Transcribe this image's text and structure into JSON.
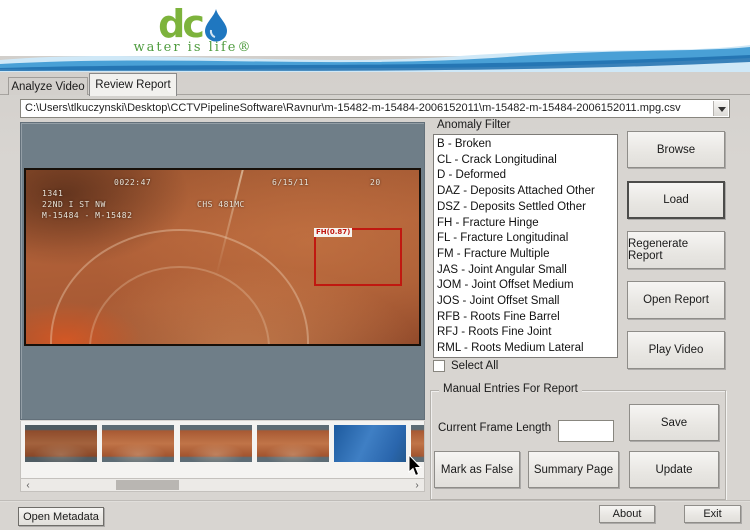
{
  "header": {
    "logo_text": "dc",
    "logo_tagline": "water is life®"
  },
  "tabs": {
    "analyze": "Analyze Video",
    "review": "Review Report"
  },
  "file_path": "C:\\Users\\tlkuczynski\\Desktop\\CCTVPipelineSoftware\\Ravnur\\m-15482-m-15484-2006152011\\m-15482-m-15484-2006152011.mpg.csv",
  "video_overlay": {
    "counter": "0022:47",
    "date": "6/15/11",
    "right_value": "20",
    "line1": "1341",
    "street": "22ND I ST NW",
    "chs": "CHS 481MC",
    "segment": "M-15484 - M-15482",
    "annotation": "FH(0.87)"
  },
  "anomaly_filter": {
    "label": "Anomaly Filter",
    "select_all": "Select All",
    "items": [
      "B - Broken",
      "CL - Crack Longitudinal",
      "D - Deformed",
      "DAZ - Deposits Attached Other",
      "DSZ - Deposits Settled Other",
      "FH - Fracture Hinge",
      "FL - Fracture Longitudinal",
      "FM - Fracture Multiple",
      "JAS - Joint Angular Small",
      "JOM - Joint Offset Medium",
      "JOS - Joint Offset Small",
      "RFB - Roots Fine Barrel",
      "RFJ - Roots Fine Joint",
      "RML - Roots Medium Lateral"
    ]
  },
  "action_buttons": {
    "browse": "Browse",
    "load": "Load",
    "regenerate_report": "Regenerate Report",
    "open_report": "Open Report",
    "play_video": "Play Video"
  },
  "manual_entries": {
    "title": "Manual Entries For Report",
    "current_frame_length_label": "Current Frame Length",
    "current_frame_length_value": "",
    "save": "Save",
    "mark_as_false": "Mark as False",
    "summary_page": "Summary Page",
    "update": "Update"
  },
  "scrollbar": {
    "left_arrow": "‹",
    "right_arrow": "›"
  },
  "footer": {
    "open_metadata": "Open Metadata",
    "about": "About",
    "exit": "Exit"
  },
  "colors": {
    "accent_blue": "#3f97cf",
    "logo_green": "#7db33c",
    "video_panel_gray": "#6f7e88",
    "annotation_red": "#c01810",
    "thumb_selected_blue": "#2e6db2"
  }
}
